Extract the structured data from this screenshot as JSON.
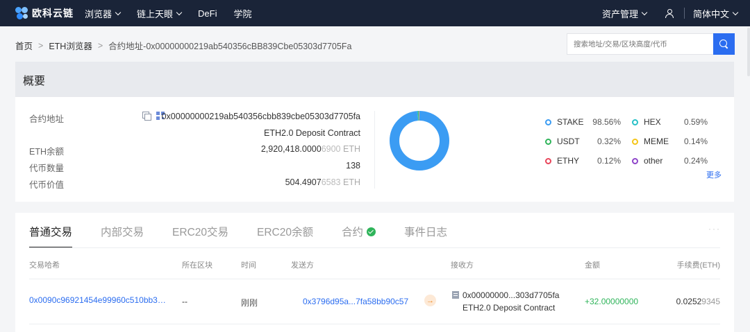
{
  "nav": {
    "logo": "欧科云链",
    "items": [
      "浏览器",
      "链上天眼",
      "DeFi",
      "学院"
    ],
    "asset_mgmt": "资产管理",
    "language": "简体中文"
  },
  "breadcrumb": {
    "home": "首页",
    "explorer": "ETH浏览器",
    "current": "合约地址-0x00000000219ab540356cBB839Cbe05303d7705Fa",
    "sep": ">"
  },
  "search": {
    "placeholder": "搜索地址/交易/区块高度/代币"
  },
  "overview": {
    "title": "概要",
    "labels": {
      "contract_address": "合约地址",
      "eth_balance": "ETH余额",
      "token_count": "代币数量",
      "token_value": "代币价值"
    },
    "contract_address": "0x00000000219ab540356cbb839cbe05303d7705fa",
    "contract_name": "ETH2.0 Deposit Contract",
    "eth_balance_main": "2,920,418.0000",
    "eth_balance_dim": "6900",
    "token_count": "138",
    "token_value_main": "504.4907",
    "token_value_dim": "6583",
    "unit": "ETH",
    "more": "更多"
  },
  "chart_data": {
    "type": "pie",
    "categories": [
      "STAKE",
      "HEX",
      "USDT",
      "MEME",
      "ETHY",
      "other"
    ],
    "values": [
      98.56,
      0.59,
      0.32,
      0.14,
      0.12,
      0.24
    ],
    "labels": [
      "98.56%",
      "0.59%",
      "0.32%",
      "0.14%",
      "0.12%",
      "0.24%"
    ],
    "colors": [
      "#3b9cf3",
      "#26c0c7",
      "#2fb45a",
      "#f5c518",
      "#e8455a",
      "#8e44c9"
    ]
  },
  "tabs": {
    "normal": "普通交易",
    "internal": "内部交易",
    "erc20_tx": "ERC20交易",
    "erc20_bal": "ERC20余额",
    "contract": "合约",
    "events": "事件日志",
    "more": "···"
  },
  "table": {
    "headers": {
      "hash": "交易哈希",
      "block": "所在区块",
      "time": "时间",
      "from": "发送方",
      "to": "接收方",
      "amount": "金额",
      "fee": "手续费(ETH)"
    },
    "rows": [
      {
        "hash": "0x0090c96921454e99960c510bb3…",
        "block": "--",
        "time": "刚刚",
        "from": "0x3796d95a...7fa58bb90c57",
        "to": "0x00000000...303d7705fa",
        "to_name": "ETH2.0 Deposit Contract",
        "amount": "+32.00000000",
        "fee_main": "0.0252",
        "fee_dim": "9345"
      }
    ]
  }
}
